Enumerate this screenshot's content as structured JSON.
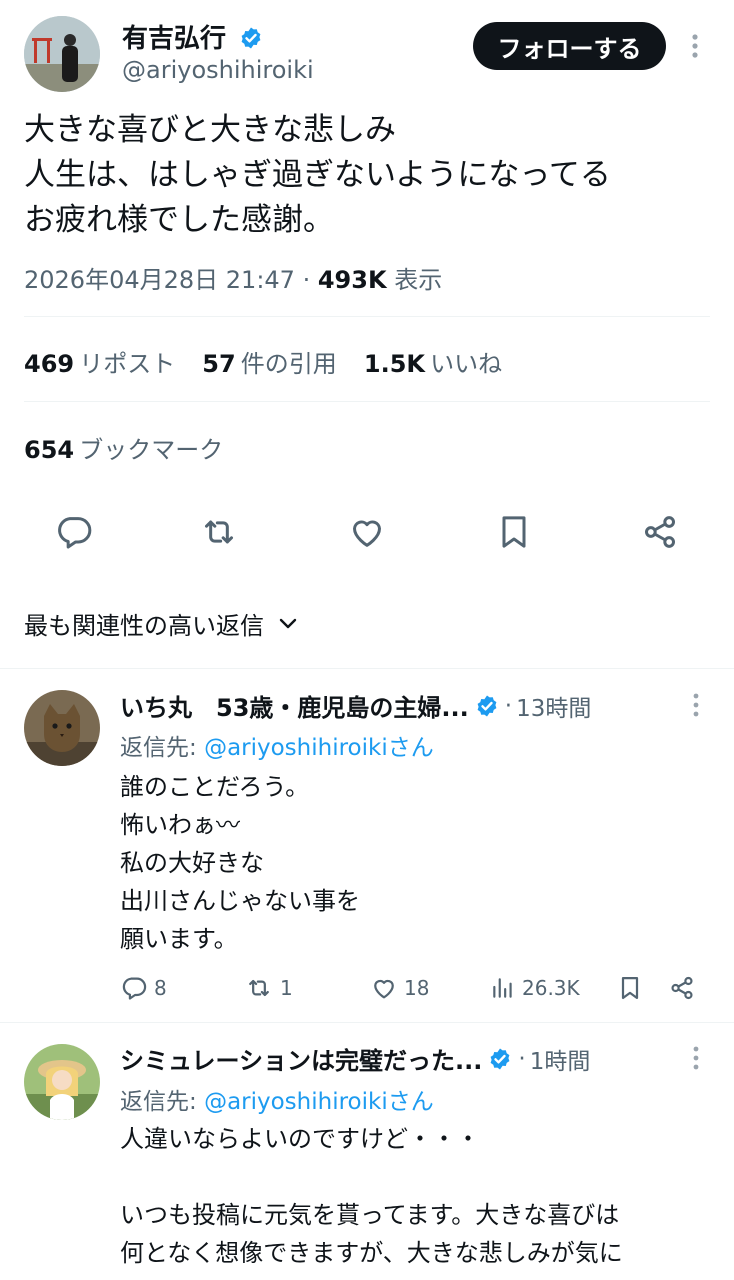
{
  "tweet": {
    "author_name": "有吉弘行",
    "author_handle": "@ariyoshihiroiki",
    "follow_label": "フォローする",
    "lines": [
      "大きな喜びと大きな悲しみ",
      "人生は、はしゃぎ過ぎないようになってる",
      "お疲れ様でした感謝。"
    ],
    "timestamp": "2026年04月28日 21:47",
    "views_count": "493K",
    "views_label": "表示",
    "reposts_count": "469",
    "reposts_label": "リポスト",
    "quotes_count": "57",
    "quotes_label": "件の引用",
    "likes_count": "1.5K",
    "likes_label": "いいね",
    "bookmarks_count": "654",
    "bookmarks_label": "ブックマーク"
  },
  "sort": {
    "label": "最も関連性の高い返信"
  },
  "replies": [
    {
      "name": "いち丸　53歳・鹿児島の主婦...",
      "time": "13時間",
      "reply_to_prefix": "返信先: ",
      "reply_to_handle": "@ariyoshihiroiki",
      "reply_to_suffix": "さん",
      "lines": [
        "誰のことだろう。",
        "怖いわぁ〰",
        "私の大好きな",
        "出川さんじゃない事を",
        "願います。"
      ],
      "replies_count": "8",
      "reposts_count": "1",
      "likes_count": "18",
      "views_count": "26.3K"
    },
    {
      "name": "シミュレーションは完璧だった...",
      "time": "1時間",
      "reply_to_prefix": "返信先: ",
      "reply_to_handle": "@ariyoshihiroiki",
      "reply_to_suffix": "さん",
      "lines": [
        "人違いならよいのですけど・・・",
        "",
        "いつも投稿に元気を貰ってます。大きな喜びは",
        "何となく想像できますが、大きな悲しみが気に"
      ]
    }
  ],
  "icons": {
    "verified": "verified-badge-icon",
    "reply": "reply-icon",
    "repost": "repost-icon",
    "like": "heart-icon",
    "bookmark": "bookmark-icon",
    "share": "share-icon",
    "views": "views-icon",
    "more": "more-dots-icon",
    "chevron": "chevron-down-icon"
  },
  "colors": {
    "accent": "#1d9bf0",
    "text": "#0f1419",
    "muted": "#536471",
    "button": "#0f1419"
  }
}
